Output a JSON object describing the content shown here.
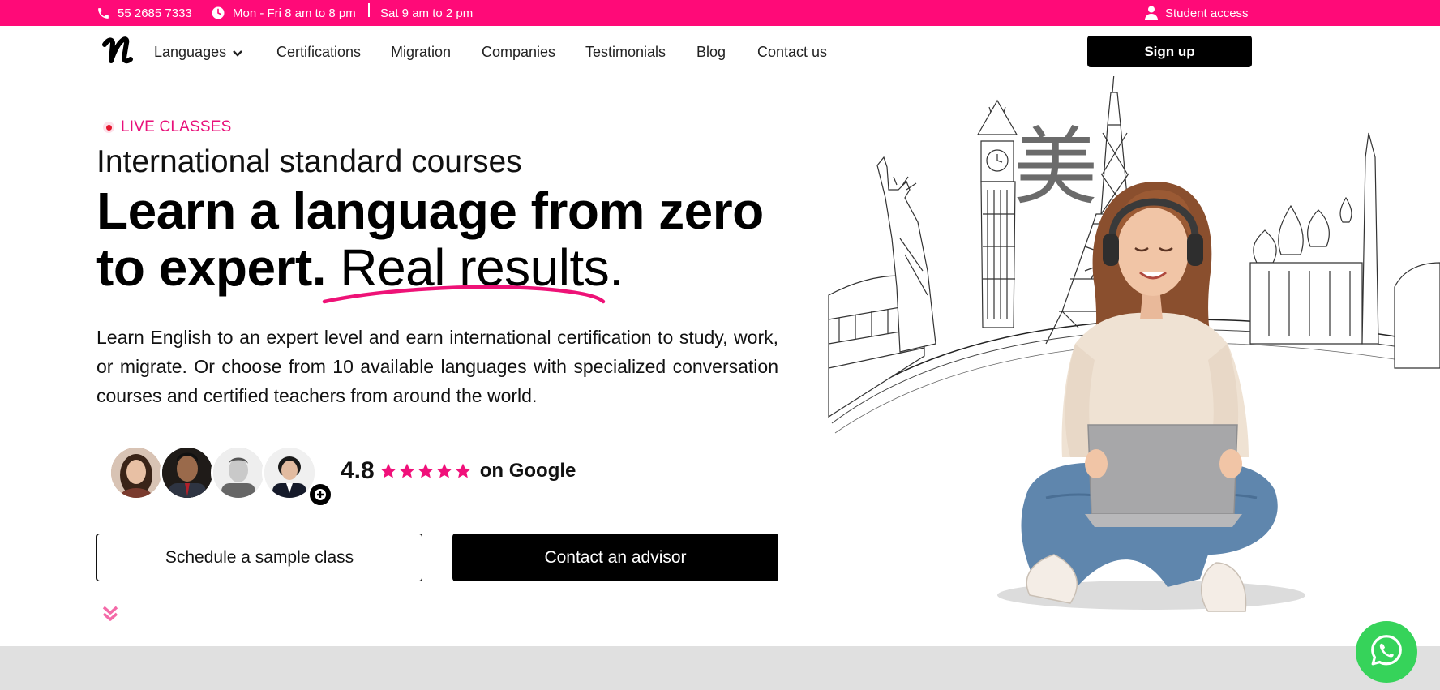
{
  "topbar": {
    "phone": "55 2685 7333",
    "weekday_hours": "Mon - Fri 8 am to 8 pm",
    "saturday_hours": "Sat 9 am to 2 pm",
    "student_access": "Student access"
  },
  "nav": {
    "items": [
      "Languages",
      "Certifications",
      "Migration",
      "Companies",
      "Testimonials",
      "Blog",
      "Contact us"
    ],
    "signup": "Sign up"
  },
  "hero": {
    "badge": "LIVE CLASSES",
    "subtitle": "International standard courses",
    "headline_line1": "Learn a language from zero",
    "headline_line2_bold": "to expert.",
    "headline_line2_light": "Real results.",
    "description": "Learn English to an expert level and earn international certification to study, work, or migrate. Or choose from 10 available languages with specialized conversation courses and certified teachers from around the world.",
    "rating_value": "4.8",
    "rating_stars": 5,
    "rating_source": "on Google",
    "cta_secondary": "Schedule a sample class",
    "cta_primary": "Contact an advisor",
    "illustration_glyph": "美"
  },
  "colors": {
    "brand_pink": "#ff0a78",
    "whatsapp_green": "#36d35a"
  },
  "icons": [
    "phone-icon",
    "clock-icon",
    "user-icon",
    "chevron-down-icon",
    "star-icon",
    "plus-icon",
    "double-chevron-down-icon",
    "whatsapp-icon"
  ]
}
